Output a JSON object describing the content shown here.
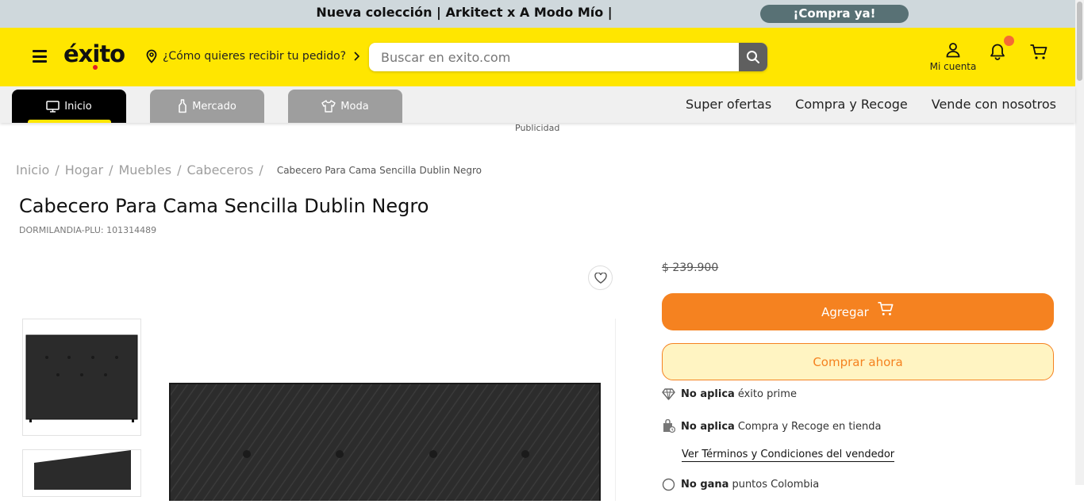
{
  "promo": {
    "text": "Nueva colección | Arkitect x A Modo Mío |",
    "cta": "¡Compra ya!"
  },
  "header": {
    "logo": "éxito",
    "location_prompt": "¿Cómo quieres recibir tu pedido?",
    "search_placeholder": "Buscar en exito.com",
    "account_label": "Mi cuenta"
  },
  "nav": {
    "tabs": [
      {
        "label": "Inicio",
        "icon": "monitor-icon"
      },
      {
        "label": "Mercado",
        "icon": "bottle-icon"
      },
      {
        "label": "Moda",
        "icon": "shirt-icon"
      }
    ],
    "links": [
      "Super ofertas",
      "Compra y Recoge",
      "Vende con nosotros"
    ]
  },
  "ad_label": "Publicidad",
  "breadcrumb": {
    "items": [
      "Inicio",
      "Hogar",
      "Muebles",
      "Cabeceros"
    ],
    "current": "Cabecero Para Cama Sencilla Dublin Negro"
  },
  "product": {
    "title": "Cabecero Para Cama Sencilla Dublin Negro",
    "plu": "DORMILANDIA-PLU: 101314489",
    "old_price": "$ 239.900",
    "add_label": "Agregar",
    "buy_label": "Comprar ahora",
    "info": [
      {
        "bold": "No aplica",
        "text": "éxito prime",
        "icon": "diamond-icon"
      },
      {
        "bold": "No aplica",
        "text": "Compra y Recoge en tienda",
        "icon": "store-pickup-icon"
      }
    ],
    "terms_link": "Ver Términos y Condiciones del vendedor",
    "partial_row": {
      "bold": "No gana",
      "text": "puntos Colombia"
    }
  },
  "colors": {
    "brand_yellow": "#ffe600",
    "accent_orange": "#f58220",
    "notification": "#f46a35"
  }
}
